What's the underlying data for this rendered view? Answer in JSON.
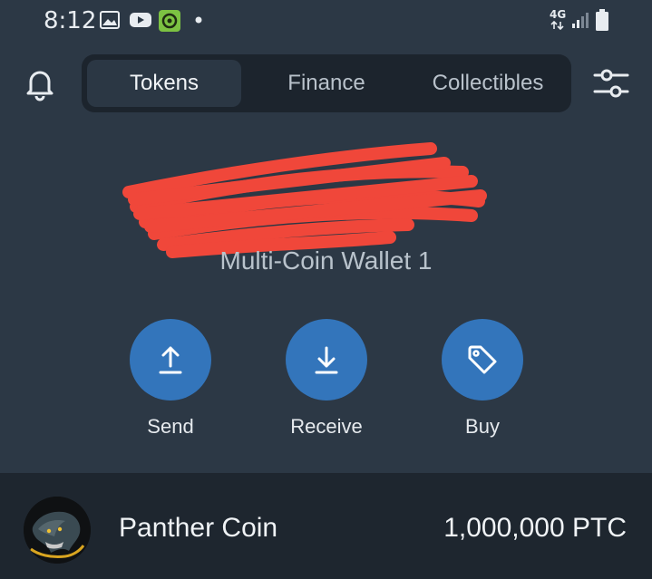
{
  "status_bar": {
    "time": "8:12",
    "network": "4G",
    "icons": [
      "gallery-icon",
      "youtube-icon",
      "app-icon",
      "notification-dot-icon",
      "signal-icon",
      "battery-icon"
    ]
  },
  "header": {
    "tabs": [
      {
        "label": "Tokens",
        "active": true
      },
      {
        "label": "Finance",
        "active": false
      },
      {
        "label": "Collectibles",
        "active": false
      }
    ]
  },
  "wallet": {
    "name": "Multi-Coin Wallet 1"
  },
  "actions": [
    {
      "label": "Send",
      "icon": "arrow-up-icon"
    },
    {
      "label": "Receive",
      "icon": "arrow-down-icon"
    },
    {
      "label": "Buy",
      "icon": "tag-icon"
    }
  ],
  "tokens": [
    {
      "name": "Panther Coin",
      "balance": "1,000,000 PTC",
      "icon": "panther-logo"
    }
  ],
  "colors": {
    "background": "#2c3845",
    "tab_container": "#1c242d",
    "action_button": "#3375bb",
    "token_row": "#1e262f",
    "redaction": "#f0473a"
  }
}
